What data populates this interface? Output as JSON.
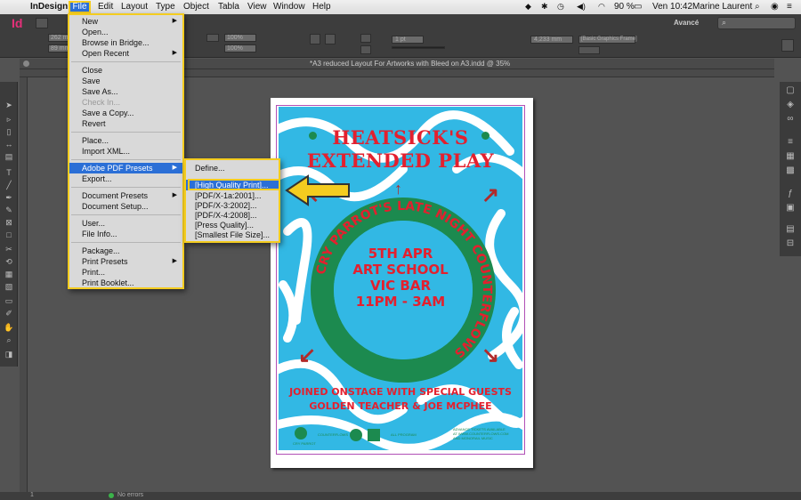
{
  "menubar": {
    "apple": "",
    "app_name": "InDesign",
    "menus": [
      "File",
      "Edit",
      "Layout",
      "Type",
      "Object",
      "Tabla",
      "View",
      "Window",
      "Help"
    ],
    "status": {
      "battery": "90 %",
      "clock": "Ven 10:42",
      "user": "Marine Laurent"
    }
  },
  "control": {
    "app_logo": "Id",
    "workspace": "Avancé",
    "zoom_a": "100%",
    "zoom_b": "100%",
    "stroke_size": "1 pt",
    "dimension": "4,233 mm",
    "frame_style": "[Basic Graphics Frame]",
    "x_value": "262 mm",
    "y_value": "89 mm"
  },
  "document": {
    "tab_title": "*A3 reduced Layout For Artworks with Bleed on A3.indd @ 35%"
  },
  "file_menu": {
    "items": [
      {
        "label": "New",
        "sub": true,
        "enabled": true
      },
      {
        "label": "Open...",
        "enabled": true
      },
      {
        "label": "Browse in Bridge...",
        "enabled": true
      },
      {
        "label": "Open Recent",
        "sub": true,
        "enabled": true
      },
      {
        "label": "Close",
        "enabled": true
      },
      {
        "label": "Save",
        "enabled": true
      },
      {
        "label": "Save As...",
        "enabled": true
      },
      {
        "label": "Check In...",
        "enabled": false
      },
      {
        "label": "Save a Copy...",
        "enabled": true
      },
      {
        "label": "Revert",
        "enabled": true
      },
      {
        "label": "Place...",
        "enabled": true
      },
      {
        "label": "Import XML...",
        "enabled": true
      },
      {
        "label": "Adobe PDF Presets",
        "sub": true,
        "enabled": true,
        "highlighted": true
      },
      {
        "label": "Export...",
        "enabled": true
      },
      {
        "label": "Document Presets",
        "sub": true,
        "enabled": true
      },
      {
        "label": "Document Setup...",
        "enabled": true
      },
      {
        "label": "User...",
        "enabled": true
      },
      {
        "label": "File Info...",
        "enabled": true
      },
      {
        "label": "Package...",
        "enabled": true
      },
      {
        "label": "Print Presets",
        "sub": true,
        "enabled": true
      },
      {
        "label": "Print...",
        "enabled": true
      },
      {
        "label": "Print Booklet...",
        "enabled": true
      }
    ]
  },
  "pdf_presets_menu": {
    "items": [
      "Define...",
      "[High Quality Print]...",
      "[PDF/X-1a:2001]...",
      "[PDF/X-3:2002]...",
      "[PDF/X-4:2008]...",
      "[Press Quality]...",
      "[Smallest File Size]..."
    ]
  },
  "poster": {
    "title_line1": "HEATSICK'S",
    "title_line2": "EXTENDED PLAY",
    "ring_text": "CRY PARROT'S LATE NIGHT COUNTERFLOWS",
    "date": "5TH APR",
    "venue1": "ART SCHOOL",
    "venue2": "VIC BAR",
    "time": "11PM - 3AM",
    "guests1": "JOINED ONSTAGE WITH SPECIAL GUESTS",
    "guests2": "GOLDEN TEACHER & JOE MCPHEE",
    "logo_cry": "CRY PARROT",
    "logo_cf": "COUNTERFLOWS",
    "all_ages": "ALL PROGRAM",
    "tickets": "ADVANCE TICKETS AVAILABLE AT WWW.COUNTERFLOWS.COM AND MONORAIL MUSIC"
  },
  "status_bar": {
    "page": "1",
    "errors": "No errors"
  },
  "colors": {
    "accent": "#f4cc1f",
    "highlight": "#2b6fd6",
    "poster_blue": "#32b8e4",
    "poster_red": "#e3202e",
    "poster_green": "#1c8a4f"
  }
}
